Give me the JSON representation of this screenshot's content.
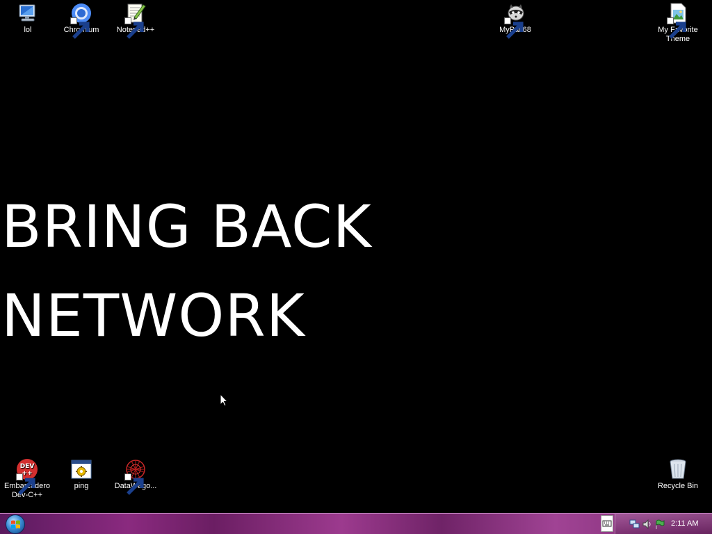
{
  "desktop": {
    "wallpaper_lines": [
      "BRING BACK",
      "NETWORK"
    ],
    "icons_top": [
      {
        "label": "lol",
        "icon": "computer-icon",
        "shortcut": false
      },
      {
        "label": "Chromium",
        "icon": "chromium-icon",
        "shortcut": true
      },
      {
        "label": "Notepad++",
        "icon": "notepad-plus-plus-icon",
        "shortcut": true
      },
      {
        "label": "MyPal 68",
        "icon": "mypal-raccoon-icon",
        "shortcut": true
      },
      {
        "label": "My Favorite Theme",
        "icon": "image-file-icon",
        "shortcut": true
      }
    ],
    "icons_bottom": [
      {
        "label": "Embarcadero Dev-C++",
        "icon": "devcpp-icon",
        "shortcut": true
      },
      {
        "label": "ping",
        "icon": "batch-file-icon",
        "shortcut": false
      },
      {
        "label": "DataWago...",
        "icon": "datawagon-icon",
        "shortcut": true
      },
      {
        "label": "Recycle Bin",
        "icon": "recycle-bin-icon",
        "shortcut": false
      }
    ]
  },
  "taskbar": {
    "start_icon": "windows-logo-icon",
    "clock": "2:11 AM",
    "tray_icons": [
      "network-icon",
      "volume-icon",
      "flag-icon"
    ]
  },
  "colors": {
    "desktop_bg": "#000000",
    "taskbar_accent": "#8a2a7f",
    "icon_text": "#ffffff"
  }
}
